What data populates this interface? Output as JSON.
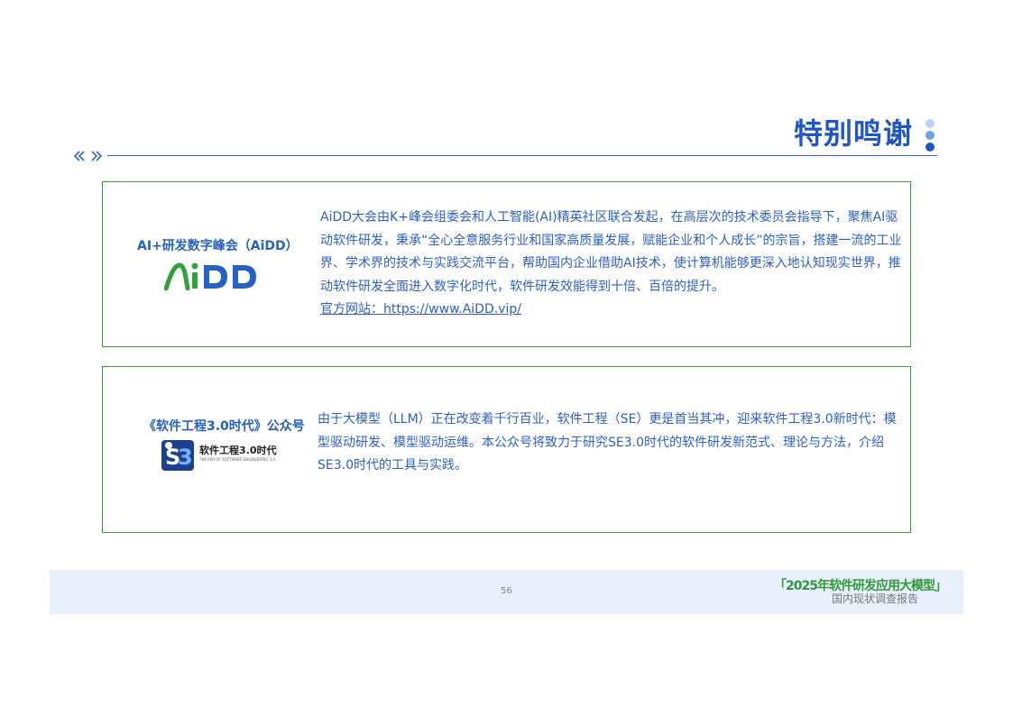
{
  "header": {
    "title": "特别鸣谢"
  },
  "cards": [
    {
      "label": "AI+研发数字峰会（AiDD）",
      "logo_text": "AiDD",
      "paragraph": "AiDD大会由K+峰会组委会和人工智能(AI)精英社区联合发起，在高层次的技术委员会指导下，聚焦AI驱动软件研发，秉承“全心全意服务行业和国家高质量发展，赋能企业和个人成长”的宗旨，搭建一流的工业界、学术界的技术与实践交流平台，帮助国内企业借助AI技术，使计算机能够更深入地认知现实世界，推动软件研发全面进入数字化时代，软件研发效能得到十倍、百倍的提升。",
      "link_text": "官方网站：https://www.AiDD.vip/"
    },
    {
      "label": "《软件工程3.0时代》公众号",
      "logo_text": "软件工程3.0时代",
      "logo_subtext": "THE ERA OF SOFTWARE ENGINEERING 3.0",
      "paragraph": "由于大模型（LLM）正在改变着千行百业，软件工程（SE）更是首当其冲，迎来软件工程3.0新时代：模型驱动研发、模型驱动运维。本公众号将致力于研究SE3.0时代的软件研发新范式、理论与方法，介绍SE3.0时代的工具与实践。"
    }
  ],
  "footer": {
    "page_number": "56",
    "report_title": "「2025年软件研发应用大模型」",
    "report_subtitle": "国内现状调查报告"
  },
  "colors": {
    "accent_blue": "#1f57c8",
    "text_blue": "#2d5fcf",
    "border_green": "#3a9a3f",
    "footer_bg": "#e8f0fb"
  },
  "icons": [
    "double-chevron-left-icon",
    "double-chevron-right-icon",
    "vertical-dots-icon"
  ]
}
